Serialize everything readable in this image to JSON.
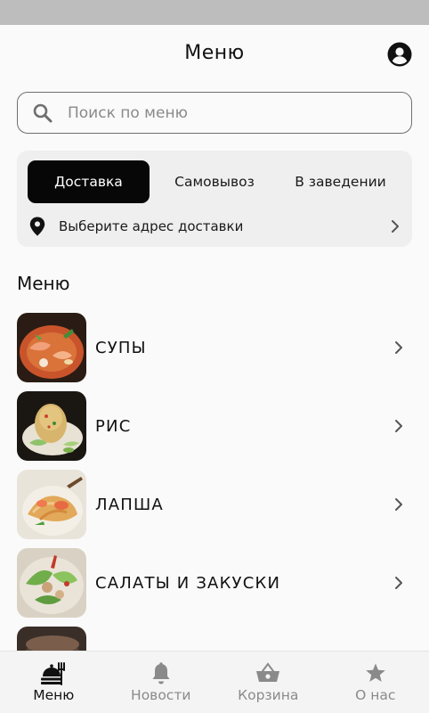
{
  "header": {
    "title": "Меню"
  },
  "search": {
    "placeholder": "Поиск по меню"
  },
  "order_modes": {
    "tabs": [
      {
        "label": "Доставка",
        "active": true
      },
      {
        "label": "Самовывоз",
        "active": false
      },
      {
        "label": "В заведении",
        "active": false
      }
    ],
    "address_prompt": "Выберите адрес доставки"
  },
  "menu": {
    "section_title": "Меню",
    "items": [
      {
        "label": "СУПЫ",
        "image": "soup-photo"
      },
      {
        "label": "РИС",
        "image": "rice-photo"
      },
      {
        "label": "ЛАПША",
        "image": "noodles-photo"
      },
      {
        "label": "САЛАТЫ И ЗАКУСКИ",
        "image": "salad-photo"
      },
      {
        "label": "",
        "image": "partial-photo"
      }
    ]
  },
  "tabbar": {
    "items": [
      {
        "label": "Меню",
        "icon": "menu-dish-icon",
        "active": true
      },
      {
        "label": "Новости",
        "icon": "bell-icon",
        "active": false
      },
      {
        "label": "Корзина",
        "icon": "basket-icon",
        "active": false
      },
      {
        "label": "О нас",
        "icon": "star-icon",
        "active": false
      }
    ]
  },
  "colors": {
    "accent": "#070707",
    "background": "#fafafa",
    "card": "#efefef",
    "inactive": "#8a8a8a"
  }
}
